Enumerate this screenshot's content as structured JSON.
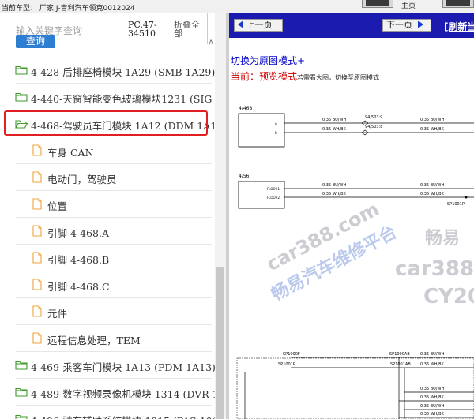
{
  "topbar": {
    "vehicle": "当前车型：  厂家:J-吉利汽车领克0012024",
    "right_label": "主页"
  },
  "left": {
    "search_placeholder": "输入关键字查询",
    "search_button": "查询",
    "col_pc": "PC.47-\n34510",
    "col_fold": "折叠全\n部",
    "col_a": "A"
  },
  "tree": [
    {
      "type": "folder",
      "label": "4-428-后排座椅模块 1A29 (SMB 1A29)"
    },
    {
      "type": "folder",
      "label": "4-440-天窗智能变色玻璃模块1231 (SIG 1"
    },
    {
      "type": "folder-open",
      "label": "4-468-驾驶员车门模块 1A12 (DDM 1A12",
      "selected": true
    },
    {
      "type": "leaf",
      "label": "车身 CAN"
    },
    {
      "type": "leaf",
      "label": "电动门，驾驶员"
    },
    {
      "type": "leaf",
      "label": "位置"
    },
    {
      "type": "leaf",
      "label": "引脚 4-468.A"
    },
    {
      "type": "leaf",
      "label": "引脚 4-468.B"
    },
    {
      "type": "leaf",
      "label": "引脚 4-468.C"
    },
    {
      "type": "leaf",
      "label": "元件"
    },
    {
      "type": "leaf",
      "label": "远程信息处理，TEM"
    },
    {
      "type": "folder",
      "label": "4-469-乘客车门模块 1A13 (PDM 1A13)"
    },
    {
      "type": "folder",
      "label": "4-489-数字视频录像机模块 1314 (DVR 13"
    },
    {
      "type": "folder",
      "label": "4-496-驻车辅助系统模块 1015 (PAS 1015"
    }
  ],
  "right": {
    "prev": "上一页",
    "next": "下一页",
    "refresh": "[刷新当",
    "orig_link": "切换为原图模式+",
    "mode_key": "当前：",
    "mode_val": "预览模式",
    "mode_hint": "若需看大图，切换至原图模式"
  },
  "diagram": {
    "conn1": "4/468",
    "conn2": "4/56",
    "wires": [
      "0.35 BU/WH",
      "0.35 WH/BK",
      "94/503:9",
      "94/503:8"
    ],
    "splices": [
      "SP1001P",
      "SP1000F",
      "SP1000AB",
      "SP1001P",
      "SP1001AB"
    ],
    "labels_small": [
      "A",
      "B",
      "FLOOR1",
      "FLOOR2"
    ]
  },
  "watermark": {
    "line1": "畅易汽车维修平台",
    "line2": "car388.com",
    "line3": "畅易",
    "line4": "car388.",
    "line5": "CY20"
  },
  "colors": {
    "nav_blue": "#1b1bb0",
    "search_blue": "#2d7dd2",
    "select_red": "#e02020",
    "folder_green": "#3c9a2a",
    "file_orange": "#f0a33a"
  }
}
